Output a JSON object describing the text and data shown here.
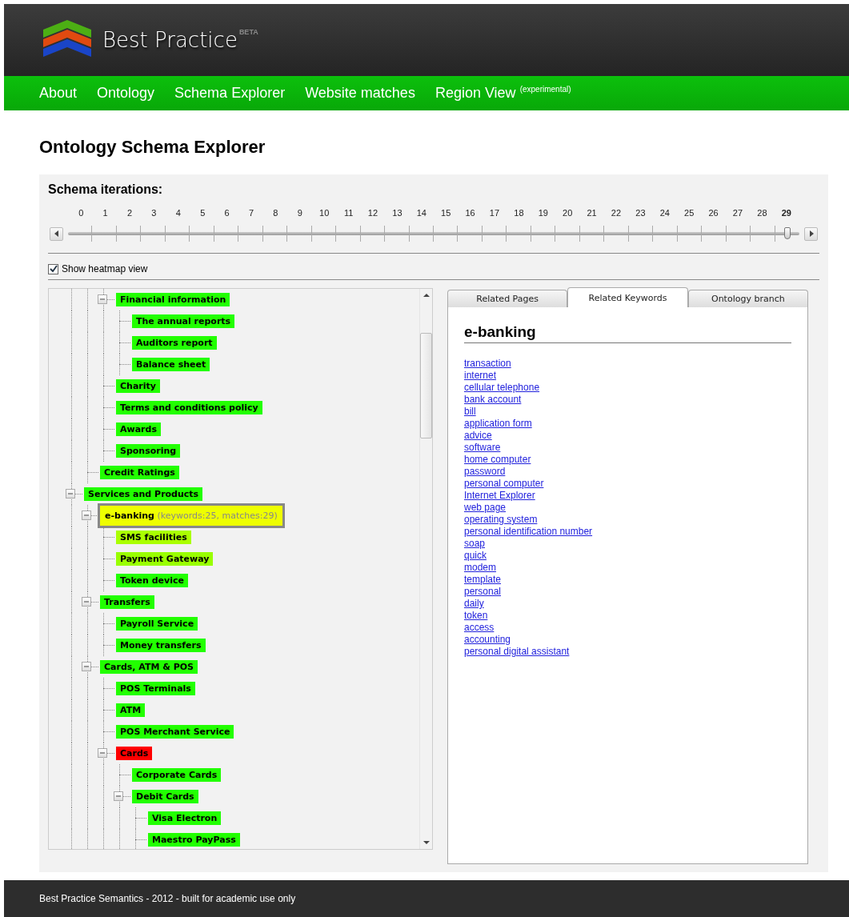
{
  "header": {
    "logo_text": "Best Practice",
    "badge": "BETA"
  },
  "nav": [
    {
      "label": "About"
    },
    {
      "label": "Ontology"
    },
    {
      "label": "Schema Explorer"
    },
    {
      "label": "Website matches"
    },
    {
      "label": "Region View $^{(experimental)}$"
    }
  ],
  "page_title": "Ontology Schema Explorer",
  "iterations": {
    "title": "Schema iterations:",
    "ticks": [
      "0",
      "1",
      "2",
      "3",
      "4",
      "5",
      "6",
      "7",
      "8",
      "9",
      "10",
      "11",
      "12",
      "13",
      "14",
      "15",
      "16",
      "17",
      "18",
      "19",
      "20",
      "21",
      "22",
      "23",
      "24",
      "25",
      "26",
      "27",
      "28",
      "29"
    ],
    "level": 1
  },
  "heatmap": {
    "label": "Show heatmap view",
    "checked": true
  },
  "tree": [
    {
      "children": [
        {
          "children": [
            {
              "label": "Financial information",
              "color": "#22ff00",
              "selected": false,
              "expanded": true,
              "children": [
                {
                  "label": "The annual reports",
                  "color": "#22ff00",
                  "selected": false
                },
                {
                  "label": "Auditors report",
                  "color": "#22ff00",
                  "selected": false
                },
                {
                  "label": "Balance sheet",
                  "color": "#22ff00",
                  "selected": false
                }
              ]
            },
            {
              "label": "Charity",
              "color": "#22ff00",
              "selected": false
            },
            {
              "label": "Terms and conditions policy",
              "color": "#22ff00",
              "selected": false
            },
            {
              "label": "Awards",
              "color": "#22ff00",
              "selected": false
            },
            {
              "label": "Sponsoring",
              "color": "#22ff00",
              "selected": false
            }
          ]
        },
        {
          "label": "Credit Ratings",
          "color": "#22ff00",
          "selected": false
        }
      ]
    },
    {
      "label": "Services and Products",
      "color": "#22ff00",
      "selected": false,
      "expanded": true,
      "children": [
        {
          "label": "e-banking",
          "detail": "(keywords:25, matches:29)",
          "color": "#eeff00",
          "selected": true,
          "expanded": true,
          "children": [
            {
              "label": "SMS facilities",
              "color": "#aaff00",
              "selected": false
            },
            {
              "label": "Payment Gateway",
              "color": "#99ff00",
              "selected": false
            },
            {
              "label": "Token device",
              "color": "#22ff00",
              "selected": false
            }
          ]
        },
        {
          "label": "Transfers",
          "color": "#22ff00",
          "selected": false,
          "expanded": true,
          "children": [
            {
              "label": "Payroll Service",
              "color": "#22ff00",
              "selected": false
            },
            {
              "label": "Money transfers",
              "color": "#22ff00",
              "selected": false
            }
          ]
        },
        {
          "label": "Cards, ATM & POS",
          "color": "#22ff00",
          "selected": false,
          "expanded": true,
          "children": [
            {
              "label": "POS Terminals",
              "color": "#22ff00",
              "selected": false
            },
            {
              "label": "ATM",
              "color": "#22ff00",
              "selected": false
            },
            {
              "label": "POS Merchant Service",
              "color": "#22ff00",
              "selected": false
            },
            {
              "label": "Cards",
              "color": "#ff0000",
              "selected": false,
              "expanded": true,
              "children": [
                {
                  "label": "Corporate Cards",
                  "color": "#22ff00",
                  "selected": false
                },
                {
                  "label": "Debit Cards",
                  "color": "#22ff00",
                  "selected": false,
                  "expanded": true,
                  "children": [
                    {
                      "label": "Visa Electron",
                      "color": "#22ff00",
                      "selected": false
                    },
                    {
                      "label": "Maestro PayPass",
                      "color": "#22ff00",
                      "selected": false
                    }
                  ]
                }
              ]
            }
          ]
        }
      ]
    }
  ],
  "tabs": [
    {
      "label": "Related Pages",
      "selected": false
    },
    {
      "label": "Related Keywords",
      "selected": true
    },
    {
      "label": "Ontology branch",
      "selected": false
    }
  ],
  "keywords_panel": {
    "heading": "e-banking",
    "keywords": [
      "transaction",
      "internet",
      "cellular telephone",
      "bank account",
      "bill",
      "application form",
      "advice",
      "software",
      "home computer",
      "password",
      "personal computer",
      "Internet Explorer",
      "web page",
      "operating system",
      "personal identification number",
      "soap",
      "quick",
      "modem",
      "template",
      "personal",
      "daily",
      "token",
      "access",
      "accounting",
      "personal digital assistant"
    ]
  },
  "footer": "Best Practice Semantics - 2012 - built for academic use only"
}
